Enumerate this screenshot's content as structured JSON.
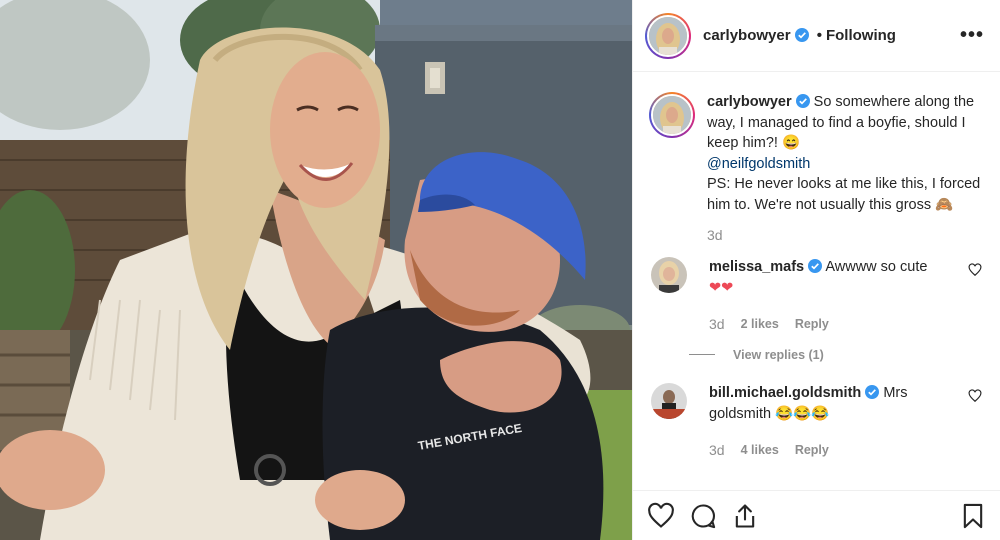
{
  "post": {
    "username": "carlybowyer",
    "follow_separator": "•",
    "follow_status": "Following",
    "more_label": "•••"
  },
  "caption": {
    "username": "carlybowyer",
    "text_line1": "So somewhere along the way, I managed to find a boyfie, should I keep him?! 😄",
    "mention": "@neilfgoldsmith",
    "text_line2": "PS: He never looks at me like this, I forced him to. We're not usually this gross 🙈",
    "time": "3d"
  },
  "comments": [
    {
      "username": "melissa_mafs",
      "text": "Awwww so cute",
      "emoji": "❤❤",
      "time": "3d",
      "likes": "2 likes",
      "reply": "Reply",
      "view_replies": "View replies (1)"
    },
    {
      "username": "bill.michael.goldsmith",
      "text": "Mrs goldsmith 😂😂😂",
      "time": "3d",
      "likes": "4 likes",
      "reply": "Reply"
    }
  ],
  "colors": {
    "verified": "#3897f0",
    "text": "#262626",
    "muted": "#8e8e8e",
    "mention": "#00376b",
    "heart": "#ed4956"
  },
  "icons": [
    "verified-icon",
    "more-options-icon",
    "heart-icon",
    "comment-icon",
    "share-icon",
    "bookmark-icon"
  ]
}
